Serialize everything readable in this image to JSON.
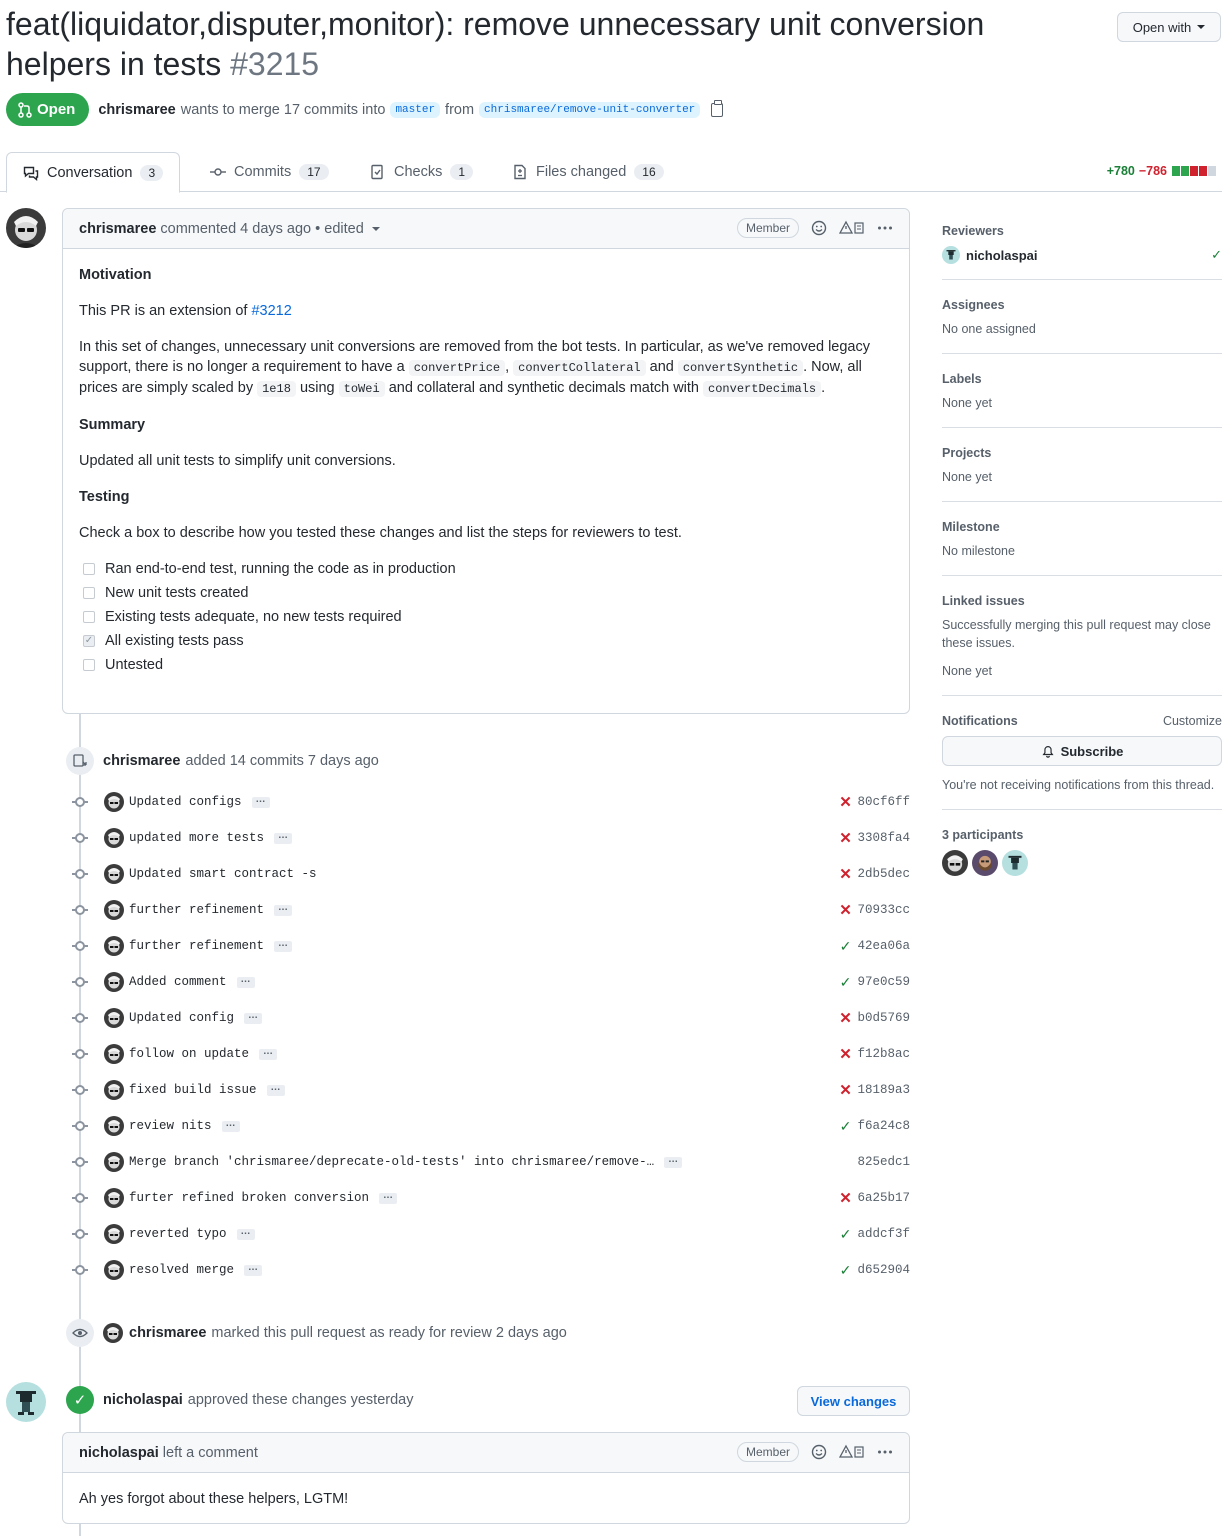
{
  "header": {
    "title": "feat(liquidator,disputer,monitor): remove unnecessary unit conversion helpers in tests",
    "number": "#3215",
    "open_with": "Open with",
    "state": "Open",
    "author": "chrismaree",
    "merge_text_1": "wants to merge 17 commits into",
    "base_branch": "master",
    "from_text": "from",
    "head_branch": "chrismaree/remove-unit-converter"
  },
  "tabs": [
    {
      "label": "Conversation",
      "count": "3"
    },
    {
      "label": "Commits",
      "count": "17"
    },
    {
      "label": "Checks",
      "count": "1"
    },
    {
      "label": "Files changed",
      "count": "16"
    }
  ],
  "diffstat": {
    "additions": "+780",
    "deletions": "−786"
  },
  "first_comment": {
    "author": "chrismaree",
    "meta": "commented 4 days ago • edited",
    "member": "Member",
    "motivation_h": "Motivation",
    "p1_text": "This PR is an extension of",
    "p1_link": "#3212",
    "p2_a": "In this set of changes, unnecessary unit conversions are removed from the bot tests. In particular, as we've removed legacy support, there is no longer a requirement to have a",
    "code1": "convertPrice",
    "comma": ",",
    "code2": "convertCollateral",
    "and": "and",
    "code3": "convertSynthetic",
    "p2_b": ". Now, all prices are simply scaled by",
    "code4": "1e18",
    "using": "using",
    "code5": "toWei",
    "p2_c": "and collateral and synthetic decimals match with",
    "code6": "convertDecimals",
    "period": ".",
    "summary_h": "Summary",
    "summary_p": "Updated all unit tests to simplify unit conversions.",
    "testing_h": "Testing",
    "testing_p": "Check a box to describe how you tested these changes and list the steps for reviewers to test.",
    "tasks": [
      {
        "label": "Ran end-to-end test, running the code as in production",
        "checked": false
      },
      {
        "label": "New unit tests created",
        "checked": false
      },
      {
        "label": "Existing tests adequate, no new tests required",
        "checked": false
      },
      {
        "label": "All existing tests pass",
        "checked": true
      },
      {
        "label": "Untested",
        "checked": false
      }
    ]
  },
  "commits_event": {
    "author": "chrismaree",
    "text": "added 14 commits 7 days ago"
  },
  "commits": [
    {
      "msg": "Updated configs",
      "sha": "80cf6ff",
      "status": "fail",
      "more": true
    },
    {
      "msg": "updated more tests",
      "sha": "3308fa4",
      "status": "fail",
      "more": true
    },
    {
      "msg": "Updated smart contract -s",
      "sha": "2db5dec",
      "status": "fail",
      "more": false
    },
    {
      "msg": "further refinement",
      "sha": "70933cc",
      "status": "fail",
      "more": true
    },
    {
      "msg": "further refinement",
      "sha": "42ea06a",
      "status": "ok",
      "more": true
    },
    {
      "msg": "Added comment",
      "sha": "97e0c59",
      "status": "ok",
      "more": true
    },
    {
      "msg": "Updated config",
      "sha": "b0d5769",
      "status": "fail",
      "more": true
    },
    {
      "msg": "follow on update",
      "sha": "f12b8ac",
      "status": "fail",
      "more": true
    },
    {
      "msg": "fixed build issue",
      "sha": "18189a3",
      "status": "fail",
      "more": true
    },
    {
      "msg": "review nits",
      "sha": "f6a24c8",
      "status": "ok",
      "more": true
    },
    {
      "msg": "Merge branch 'chrismaree/deprecate-old-tests' into chrismaree/remove-…",
      "sha": "825edc1",
      "status": "none",
      "more": true
    },
    {
      "msg": "furter refined broken conversion",
      "sha": "6a25b17",
      "status": "fail",
      "more": true
    },
    {
      "msg": "reverted typo",
      "sha": "addcf3f",
      "status": "ok",
      "more": true
    },
    {
      "msg": "resolved merge",
      "sha": "d652904",
      "status": "ok",
      "more": true
    }
  ],
  "ready_event": {
    "author": "chrismaree",
    "text": "marked this pull request as ready for review 2 days ago"
  },
  "approval": {
    "author": "nicholaspai",
    "text": "approved these changes yesterday",
    "view_changes": "View changes"
  },
  "second_comment": {
    "author": "nicholaspai",
    "meta": "left a comment",
    "member": "Member",
    "body": "Ah yes forgot about these helpers, LGTM!"
  },
  "sidebar": {
    "reviewers_title": "Reviewers",
    "reviewer": "nicholaspai",
    "assignees_title": "Assignees",
    "assignees_value": "No one assigned",
    "labels_title": "Labels",
    "labels_value": "None yet",
    "projects_title": "Projects",
    "projects_value": "None yet",
    "milestone_title": "Milestone",
    "milestone_value": "No milestone",
    "linked_title": "Linked issues",
    "linked_desc": "Successfully merging this pull request may close these issues.",
    "linked_value": "None yet",
    "notifications_title": "Notifications",
    "customize": "Customize",
    "subscribe": "Subscribe",
    "not_receiving": "You're not receiving notifications from this thread.",
    "participants_title": "3 participants"
  },
  "colors": {
    "green": "#2da44e",
    "red": "#cf222e",
    "link": "#0969da",
    "muted": "#57606a"
  },
  "icons": [
    "pull-request-icon",
    "comment-discussion-icon",
    "commit-icon",
    "checklist-icon",
    "file-diff-icon",
    "smiley-icon",
    "kebab-icon",
    "check-icon",
    "x-icon",
    "eye-icon",
    "bell-icon",
    "copy-icon"
  ]
}
